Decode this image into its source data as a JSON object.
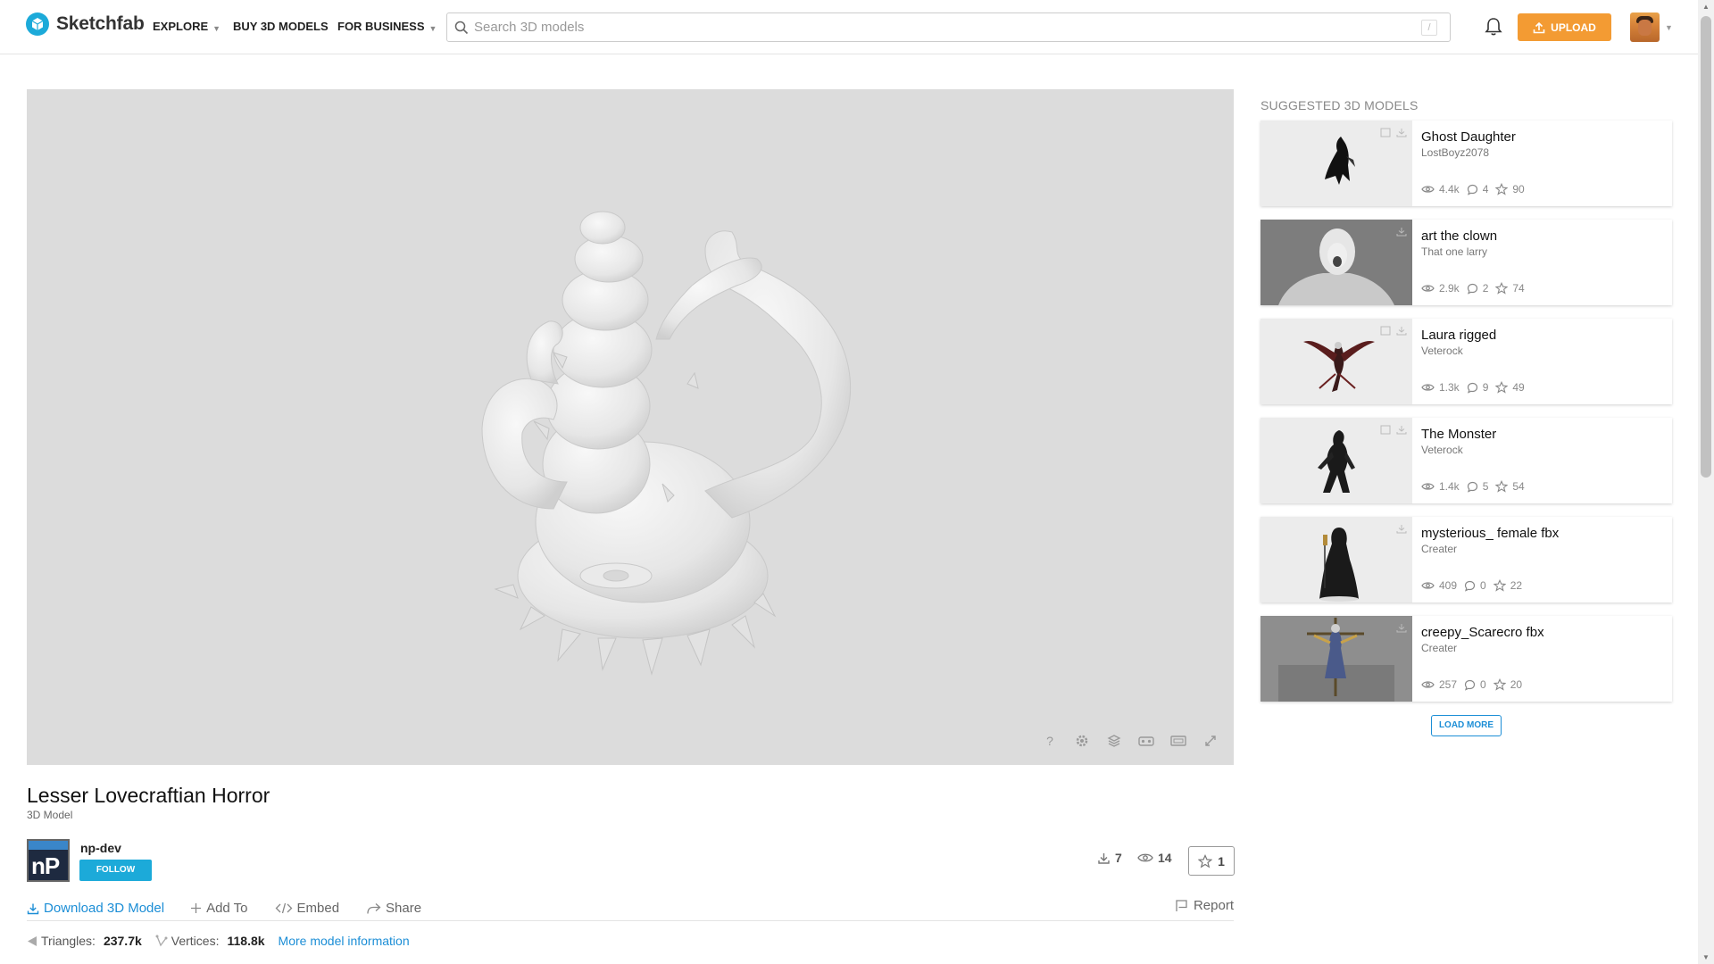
{
  "header": {
    "brand": "Sketchfab",
    "nav": {
      "explore": "EXPLORE",
      "buy": "BUY 3D MODELS",
      "business": "FOR BUSINESS"
    },
    "search_placeholder": "Search 3D models",
    "search_shortcut": "/",
    "upload_label": "UPLOAD"
  },
  "model": {
    "title": "Lesser Lovecraftian Horror",
    "subtitle": "3D Model",
    "author": "np-dev",
    "author_avatar_text": "nP",
    "follow_label": "FOLLOW",
    "downloads": "7",
    "views": "14",
    "likes": "1",
    "actions": {
      "download": "Download 3D Model",
      "add_to": "Add To",
      "embed": "Embed",
      "share": "Share",
      "report": "Report"
    },
    "meta": {
      "triangles_label": "Triangles:",
      "triangles_value": "237.7k",
      "vertices_label": "Vertices:",
      "vertices_value": "118.8k",
      "more_info": "More model information"
    },
    "viewer_tools": [
      "help-icon",
      "settings-icon",
      "layers-icon",
      "vr-icon",
      "widescreen-icon",
      "fullscreen-icon"
    ],
    "viewer_help_glyph": "?"
  },
  "sidebar": {
    "title": "SUGGESTED 3D MODELS",
    "load_more": "LOAD MORE",
    "cards": [
      {
        "title": "Ghost Daughter",
        "author": "LostBoyz2078",
        "views": "4.4k",
        "comments": "4",
        "likes": "90",
        "thumb_bg": "#ececec"
      },
      {
        "title": "art the clown",
        "author": "That one larry",
        "views": "2.9k",
        "comments": "2",
        "likes": "74",
        "thumb_bg": "#8a8a8a"
      },
      {
        "title": "Laura rigged",
        "author": "Veterock",
        "views": "1.3k",
        "comments": "9",
        "likes": "49",
        "thumb_bg": "#ececec"
      },
      {
        "title": "The Monster",
        "author": "Veterock",
        "views": "1.4k",
        "comments": "5",
        "likes": "54",
        "thumb_bg": "#ececec"
      },
      {
        "title": "mysterious_ female fbx",
        "author": "Creater",
        "views": "409",
        "comments": "0",
        "likes": "22",
        "thumb_bg": "#ececec"
      },
      {
        "title": "creepy_Scarecro fbx",
        "author": "Creater",
        "views": "257",
        "comments": "0",
        "likes": "20",
        "thumb_bg": "#8c8c8c"
      }
    ]
  },
  "colors": {
    "brand_blue": "#1caad9",
    "upload_orange": "#f39b33",
    "link_blue": "#1c8ed6",
    "viewer_bg": "#dcdcdc"
  }
}
